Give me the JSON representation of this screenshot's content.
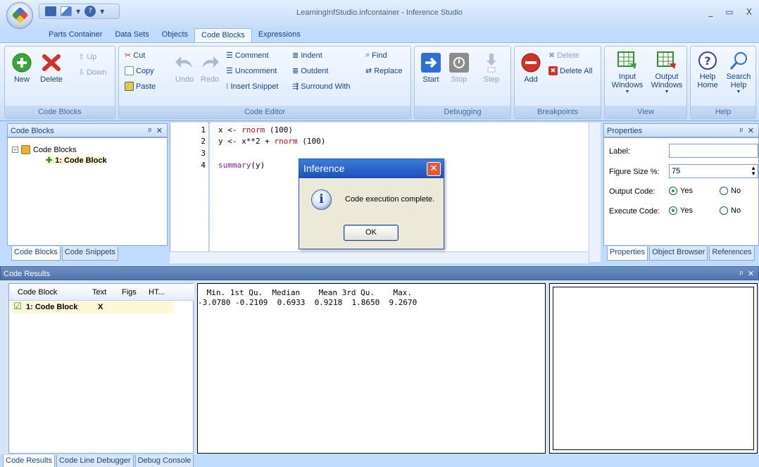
{
  "window": {
    "title": "LearningInfStudio.infcontainer - Inference Studio",
    "controls": [
      "_",
      "▭",
      "X"
    ]
  },
  "ribbon_tabs": [
    "Parts Container",
    "Data Sets",
    "Objects",
    "Code Blocks",
    "Expressions"
  ],
  "active_tab": "Code Blocks",
  "ribbon": {
    "code_blocks": {
      "label": "Code Blocks",
      "new": "New",
      "delete": "Delete",
      "up": "Up",
      "down": "Down"
    },
    "code_editor": {
      "label": "Code Editor",
      "cut": "Cut",
      "copy": "Copy",
      "paste": "Paste",
      "undo": "Undo",
      "redo": "Redo",
      "comment": "Comment",
      "uncomment": "Uncomment",
      "insert_snippet": "Insert Snippet",
      "indent": "Indent",
      "outdent": "Outdent",
      "surround_with": "Surround With",
      "find": "Find",
      "replace": "Replace"
    },
    "debugging": {
      "label": "Debugging",
      "start": "Start",
      "stop": "Stop",
      "step": "Step"
    },
    "breakpoints": {
      "label": "Breakpoints",
      "add": "Add",
      "delete": "Delete",
      "delete_all": "Delete All"
    },
    "view": {
      "label": "View",
      "input_windows": [
        "Input",
        "Windows"
      ],
      "output_windows": [
        "Output",
        "Windows"
      ]
    },
    "help": {
      "label": "Help",
      "help_home": [
        "Help",
        "Home"
      ],
      "search_help": [
        "Search",
        "Help"
      ]
    }
  },
  "code_blocks_panel": {
    "title": "Code Blocks",
    "tree_root": "Code Blocks",
    "tree_child": "1: Code Block",
    "tabs": [
      "Code Blocks",
      "Code Snippets"
    ]
  },
  "editor": {
    "line_numbers": [
      "1",
      "2",
      "3",
      "4"
    ],
    "lines": {
      "l1_a": "x <- ",
      "l1_b": "rnorm",
      "l1_c": " (100)",
      "l2_a": "y <- x**2 + ",
      "l2_b": "rnorm",
      "l2_c": " (100)",
      "l4_a": "summary",
      "l4_b": "(y)"
    }
  },
  "dialog": {
    "title": "Inference",
    "message": "Code execution complete.",
    "ok": "OK"
  },
  "properties_panel": {
    "title": "Properties",
    "label_field": "Label:",
    "label_value": "",
    "figure_size_label": "Figure Size %:",
    "figure_size_value": "75",
    "output_code_label": "Output Code:",
    "execute_code_label": "Execute Code:",
    "yes": "Yes",
    "no": "No",
    "tabs": [
      "Properties",
      "Object Browser",
      "References"
    ]
  },
  "code_results": {
    "title": "Code Results",
    "columns": [
      "Code Block",
      "Text",
      "Figs",
      "HT..."
    ],
    "row_name": "1: Code Block",
    "row_text": "X",
    "output_header": " Min. 1st Qu.  Median    Mean 3rd Qu.    Max.",
    "output_values": "-3.0780 -0.2109  0.6933  0.9218  1.8650  9.2670"
  },
  "bottom_tabs": [
    "Code Results",
    "Code Line Debugger",
    "Debug Console"
  ],
  "colors": {
    "accent": "#15428b",
    "ribbon_bg": "#dce9fb",
    "dialog_title": "#1b4fb8"
  }
}
